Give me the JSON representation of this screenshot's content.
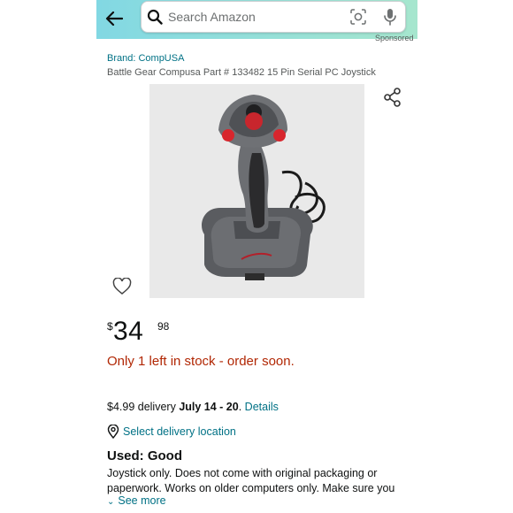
{
  "header": {
    "search_placeholder": "Search Amazon",
    "sponsored_label": "Sponsored",
    "icons": [
      "back-arrow-icon",
      "search-icon",
      "camera-lens-icon",
      "microphone-icon"
    ]
  },
  "product": {
    "brand": "Brand: CompUSA",
    "title": "Battle Gear Compusa Part # 133482 15 Pin Serial PC Joystick",
    "image_alt": "Gray and black joystick with red buttons"
  },
  "price": {
    "symbol": "$",
    "whole": "34",
    "fraction": "98"
  },
  "stock_message": "Only 1 left in stock - order soon.",
  "delivery": {
    "prefix": "$4.99 delivery ",
    "dates": "July 14 - 20",
    "separator": ". ",
    "details_link": "Details"
  },
  "location": {
    "label": "Select delivery location"
  },
  "condition": {
    "title": "Used: Good",
    "description": "Joystick only. Does not come with original packaging or paperwork. Works on older computers only. Make sure you",
    "see_more": "See more"
  },
  "colors": {
    "header_gradient_start": "#82d8e3",
    "header_gradient_end": "#a6e6ce",
    "link": "#007185",
    "price_alert": "#b12704",
    "text": "#0f1111"
  }
}
